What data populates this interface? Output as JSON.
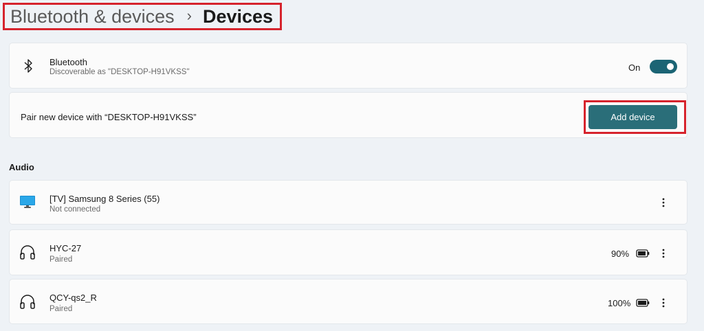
{
  "breadcrumb": {
    "parent": "Bluetooth & devices",
    "separator": "›",
    "current": "Devices"
  },
  "bluetooth": {
    "title": "Bluetooth",
    "subtitle": "Discoverable as \"DESKTOP-H91VKSS\"",
    "toggle_label": "On",
    "toggle_state": true,
    "icon": "bluetooth-icon"
  },
  "pair": {
    "label": "Pair new device with “DESKTOP-H91VKSS”",
    "button_label": "Add device"
  },
  "audio": {
    "header": "Audio",
    "devices": [
      {
        "name": "[TV] Samsung 8 Series (55)",
        "status": "Not connected",
        "icon": "tv-icon"
      },
      {
        "name": "HYC-27",
        "status": "Paired",
        "battery": "90%",
        "icon": "headphones-icon"
      },
      {
        "name": "QCY-qs2_R",
        "status": "Paired",
        "battery": "100%",
        "icon": "headphones-icon"
      }
    ]
  },
  "colors": {
    "accent": "#2a6e79",
    "toggle": "#1b6474",
    "highlight": "#d6232c",
    "background": "#eef2f6"
  }
}
